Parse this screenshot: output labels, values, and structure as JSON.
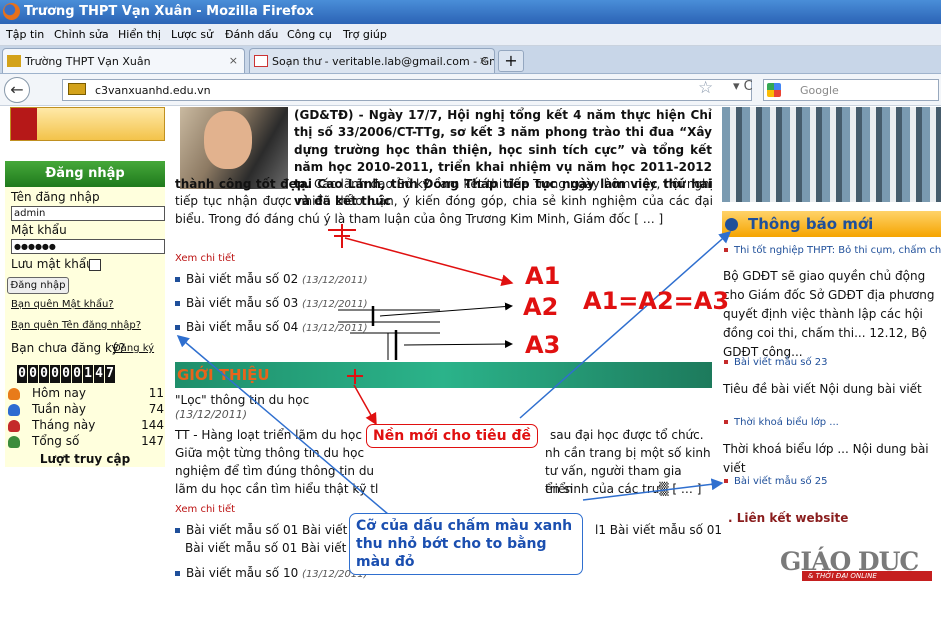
{
  "window": {
    "title": "Trương THPT Vạn Xuân - Mozilla Firefox"
  },
  "menu": [
    "Tập tin",
    "Chỉnh sửa",
    "Hiển thị",
    "Lược sử",
    "Đánh dấu",
    "Công cụ",
    "Trợ giúp"
  ],
  "tabs": [
    {
      "label": "Trường THPT Vạn Xuân",
      "close": "×"
    },
    {
      "label": "Soạn thư - veritable.lab@gmail.com - Gmail",
      "close": "×"
    }
  ],
  "newtab_label": "+",
  "nav": {
    "url": "c3vanxuanhd.edu.vn",
    "search_placeholder": "Google",
    "back_symbol": "←",
    "star_symbol": "☆",
    "reload_symbol": "▾ C"
  },
  "sidebar": {
    "login_title": "Đăng nhập",
    "username_label": "Tên đăng nhập",
    "username_value": "admin",
    "password_label": "Mật khẩu",
    "password_value": "●●●●●●",
    "remember_label": "Lưu mật khẩu!",
    "login_button": "Đăng nhập",
    "forgot_password": "Bạn quên Mật khẩu?",
    "forgot_username": "Bạn quên Tên đăng nhập?",
    "no_account": "Bạn chưa đăng ký?",
    "register": "Đăng ký",
    "counter_digits": [
      "0",
      "0",
      "0",
      "0",
      "0",
      "0",
      "1",
      "4",
      "7"
    ],
    "stats": [
      {
        "label": "Hôm nay",
        "value": "11",
        "color": "#e87b1a"
      },
      {
        "label": "Tuần này",
        "value": "74",
        "color": "#2d6bd1"
      },
      {
        "label": "Tháng này",
        "value": "144",
        "color": "#c42a2a"
      },
      {
        "label": "Tổng số",
        "value": "147",
        "color": "#3c8c3c"
      }
    ],
    "visits_title": "Lượt truy cập"
  },
  "article": {
    "lead_bold": "(GD&TĐ) - Ngày 17/7, Hội nghị tổng kết 4 năm thực hiện Chỉ thị số 33/2006/CT-TTg, sơ kết 3 năm phong trào thi đua “Xây dựng trường học thân thiện, học sinh tích cực” và tổng kết năm học 2010-2011, triển khai nhiệm vụ năm học 2011-2012 tại Cao Lãnh, tỉnh Đồng Tháp tiếp tục ngày  làm việc  thứ hai và đã kết thúc",
    "lead_bold_end": "thành công tốt đẹp.",
    "lead_rest": " Các lãnh đạo Sở ký cam kết thi đua Trong ngày hôm nay, hội nghị tiếp tục nhận được nhiều thảo luận, ý kiến đóng góp, chia sẻ kinh nghiệm  của các đại biểu. Trong đó đáng chú ý là tham luận của ông Trương Kim Minh, Giám đốc [ … ]",
    "read_more": "Xem chi tiết",
    "list": [
      {
        "title": "Bài viết mẫu số 02",
        "date": "(13/12/2011)"
      },
      {
        "title": "Bài viết mẫu số 03",
        "date": "(13/12/2011)"
      },
      {
        "title": "Bài viết mẫu số 04",
        "date": "(13/12/2011)"
      }
    ]
  },
  "intro": {
    "heading": "GIỚI THIỆU",
    "title": "\"Lọc\" thông tin du học",
    "date": "(13/12/2011)",
    "body_lines": [
      "TT - Hàng loạt triển lãm du học",
      "Giữa một từng thông tin du học",
      "nghiệm để tìm đúng thông tin du",
      "lãm du học cần tìm hiểu thật kỹ tl"
    ],
    "body_right": [
      "sau đại học được tổ chức.",
      "nh cần trang bị một số kinh",
      "tư vấn, người tham gia triển",
      "ển sinh của các trư▒ [ … ]"
    ],
    "read_more": "Xem chi tiết",
    "list_row1_a": "Bài viết mẫu số 01  Bài viết mẫ",
    "list_row1_b": "l1  Bài viết mẫu số 01",
    "list_row2": "Bài viết mẫu số 01  Bài viết mẫ",
    "list_row3": "Bài viết mẫu số 10",
    "list_row3_date": "(13/12/2011)"
  },
  "right": {
    "notice_title": "Thông báo mới",
    "notice_link": "Thi tốt nghiệp THPT: Bỏ thi cụm, chấm chéo",
    "notice_text": "Bộ GDĐT sẽ giao quyền chủ động cho Giám đốc Sở GDĐT địa phương quyết định việc thành lập các hội đồng coi thi, chấm thi... 12.12, Bộ GDĐT công...",
    "items": [
      {
        "link": "Bài viết mẫu số 23",
        "text": "Tiêu đề bài viết Nội dung bài viết"
      },
      {
        "link": "Thời khoá biểu lớp ...",
        "text": "Thời khoá biểu lớp ... Nội dung bài viết"
      },
      {
        "link": "Bài viết mẫu số 25",
        "text": ""
      }
    ],
    "links_title": ". Liên kết website",
    "gd_logo": "GIÁO DỤC",
    "gd_sub": "& THỜI ĐẠI ONLINE"
  },
  "annotations": {
    "a1": "A1",
    "a2": "A2",
    "a3": "A3",
    "equation": "A1=A2=A3",
    "callout_heading": "Nền mới cho tiêu đề",
    "callout_dots": "Cỡ của dấu chấm màu xanh thu nhỏ bớt cho to bằng màu đỏ"
  },
  "colors": {
    "annotation_red": "#e01010",
    "callout_blue": "#2f6fcf",
    "heading_orange": "#e8641b"
  }
}
